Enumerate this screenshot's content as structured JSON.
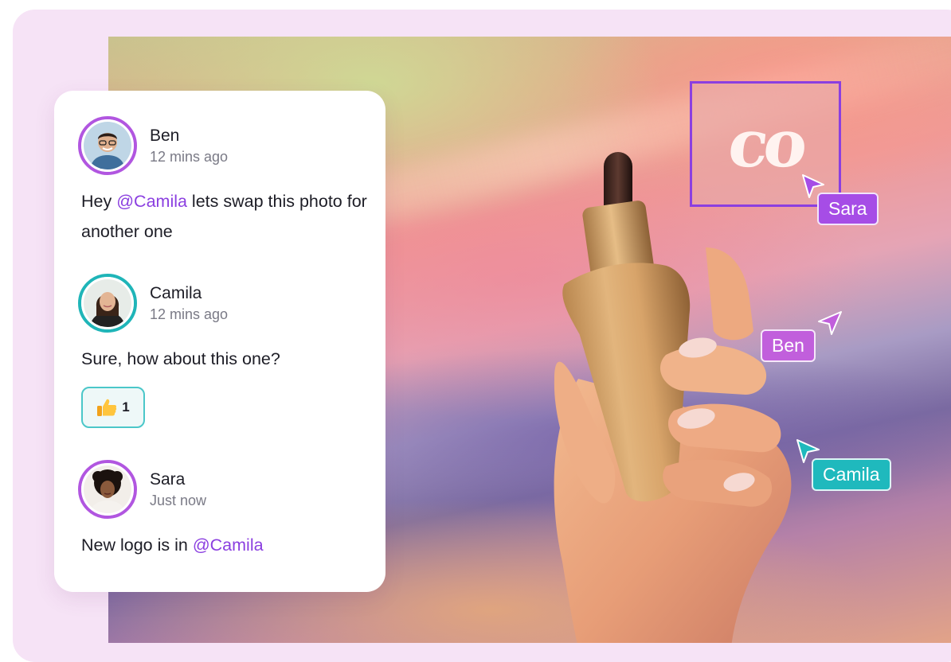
{
  "comments": [
    {
      "author": "Ben",
      "time": "12 mins ago",
      "text_before": "Hey ",
      "mention": "@Camila",
      "text_after": " lets swap this photo for another one",
      "avatar_ring": "#b156e0"
    },
    {
      "author": "Camila",
      "time": "12 mins ago",
      "text": "Sure, how about this one?",
      "avatar_ring": "#1fb5b8",
      "reaction": {
        "emoji": "thumbs-up-icon",
        "count": "1"
      }
    },
    {
      "author": "Sara",
      "time": "Just now",
      "text_before": "New logo is in ",
      "mention": "@Camila",
      "avatar_ring": "#b156e0"
    }
  ],
  "canvas": {
    "logo_text": "co",
    "logo_selection_color": "#8b3fe0",
    "cursors": [
      {
        "name": "Sara",
        "color": "#a64de6"
      },
      {
        "name": "Ben",
        "color": "#c15fdc"
      },
      {
        "name": "Camila",
        "color": "#1fb9bd"
      }
    ]
  },
  "colors": {
    "mention": "#8b3fe0",
    "reaction_border": "#4bc7c9",
    "frame_background": "#f6e3f6"
  }
}
